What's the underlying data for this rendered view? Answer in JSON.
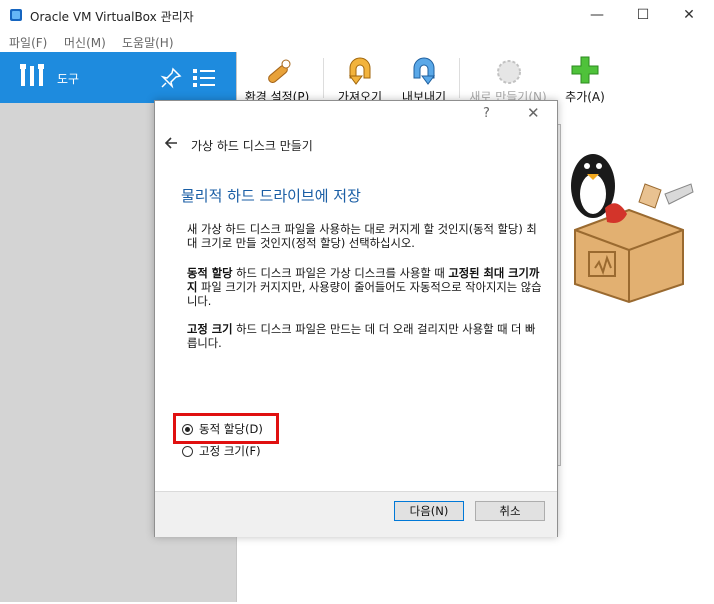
{
  "window": {
    "title": "Oracle VM VirtualBox 관리자",
    "minimize": "—",
    "maximize": "☐",
    "close": "✕"
  },
  "menu": [
    "파일(F)",
    "머신(M)",
    "도움말(H)"
  ],
  "sidebar": {
    "tools_label": "도구"
  },
  "toolbar": {
    "preferences": "환경 설정(P)",
    "import": "가져오기",
    "export": "내보내기",
    "new": "새로 만들기(N)",
    "add": "추가(A)"
  },
  "dialog": {
    "help": "?",
    "close": "✕",
    "header_title": "가상 하드 디스크 만들기",
    "page_title": "물리적 하드 드라이브에 저장",
    "intro": "새 가상 하드 디스크 파일을 사용하는 대로 커지게 할 것인지(동적 할당) 최대 크기로 만들 것인지(정적 할당) 선택하십시오.",
    "dynamic_bold1": "동적 할당",
    "dynamic_text1": " 하드 디스크 파일은 가상 디스크를 사용할 때 ",
    "dynamic_bold2": "고정된 최대 크기까지",
    "dynamic_text2": " 파일 크기가 커지지만, 사용량이 줄어들어도 자동적으로 작아지지는 않습니다.",
    "fixed_bold": "고정 크기",
    "fixed_text": " 하드 디스크 파일은 만드는 데 더 오래 걸리지만 사용할 때 더 빠릅니다.",
    "options": [
      {
        "label": "동적 할당(D)",
        "checked": true
      },
      {
        "label": "고정 크기(F)",
        "checked": false
      }
    ],
    "next_button": "다음(N)",
    "cancel_button": "취소"
  },
  "colors": {
    "accent": "#1e8bde",
    "title_blue": "#1a5ea5",
    "highlight": "#e01010"
  }
}
